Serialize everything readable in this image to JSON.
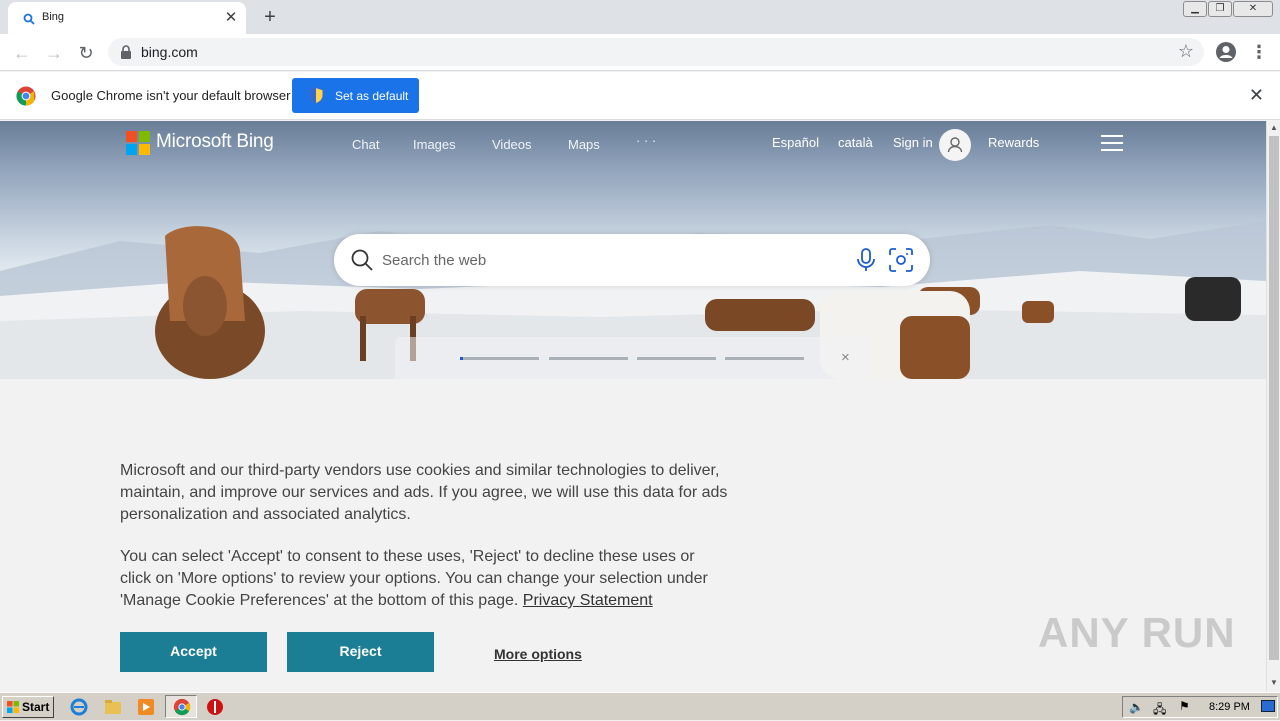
{
  "browser": {
    "tab_title": "Bing",
    "url": "bing.com",
    "icons": [
      "bing-search-icon",
      "back-arrow-icon",
      "forward-arrow-icon",
      "reload-icon",
      "lock-icon",
      "star-icon",
      "profile-icon",
      "more-vert-icon"
    ]
  },
  "infobar": {
    "message": "Google Chrome isn't your default browser",
    "set_default_label": "Set as default"
  },
  "bing": {
    "logo_text": "Microsoft Bing",
    "nav": [
      "Chat",
      "Images",
      "Videos",
      "Maps",
      "· · ·"
    ],
    "lang1": "Español",
    "lang2": "català",
    "sign_in": "Sign in",
    "rewards": "Rewards",
    "search_placeholder": "Search the web",
    "carousel_close": "×"
  },
  "cookie": {
    "para1": "Microsoft and our third-party vendors use cookies and similar technologies to deliver, maintain, and improve our services and ads. If you agree, we will use this data for ads personalization and associated analytics.",
    "para2": "You can select 'Accept' to consent to these uses, 'Reject' to decline these uses or click on 'More options' to review your options. You can change your selection under 'Manage Cookie Preferences' at the bottom of this page.",
    "privacy_link": "Privacy Statement",
    "accept": "Accept",
    "reject": "Reject",
    "more_options": "More options"
  },
  "watermark": "ANY RUN",
  "taskbar": {
    "start": "Start",
    "clock": "8:29 PM"
  },
  "colors": {
    "chrome_blue": "#1a73e8",
    "cookie_button": "#1b7e95",
    "ms_red": "#f25022",
    "ms_green": "#7fba00",
    "ms_blue": "#00a4ef",
    "ms_yellow": "#ffb900"
  }
}
